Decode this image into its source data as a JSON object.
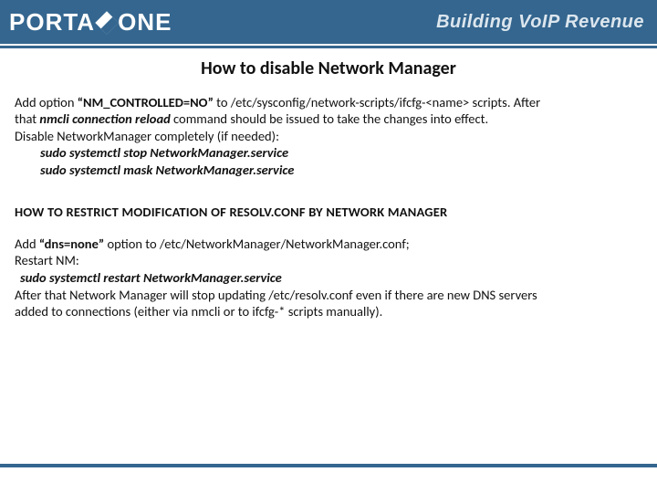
{
  "header": {
    "brand_left": "PORTA",
    "brand_right": "ONE",
    "tagline": "Building VoIP Revenue"
  },
  "title": "How to disable Network Manager",
  "sec1": {
    "l1a": "Add option ",
    "l1b": "“NM_CONTROLLED=NO”",
    "l1c": " to /etc/sysconfig/network-scripts/ifcfg-<name> scripts. After",
    "l2a": "that ",
    "l2b": "nmcli connection reload",
    "l2c": " command should be issued to take the changes into effect.",
    "l3": "Disable NetworkManager completely (if needed):",
    "cmd1": "sudo systemctl stop NetworkManager.service",
    "cmd2": "sudo systemctl mask NetworkManager.service"
  },
  "subhead": "HOW TO RESTRICT MODIFICATION OF RESOLV.CONF BY NETWORK MANAGER",
  "sec2": {
    "l1a": "Add ",
    "l1b": "“dns=none”",
    "l1c": " option to /etc/NetworkManager/NetworkManager.conf;",
    "l2": "Restart NM:",
    "cmd": "sudo systemctl restart NetworkManager.service",
    "l3": "After that Network Manager will stop updating /etc/resolv.conf even if there are new DNS servers",
    "l4": "added to connections (either via nmcli or to ifcfg-* scripts manually)."
  }
}
